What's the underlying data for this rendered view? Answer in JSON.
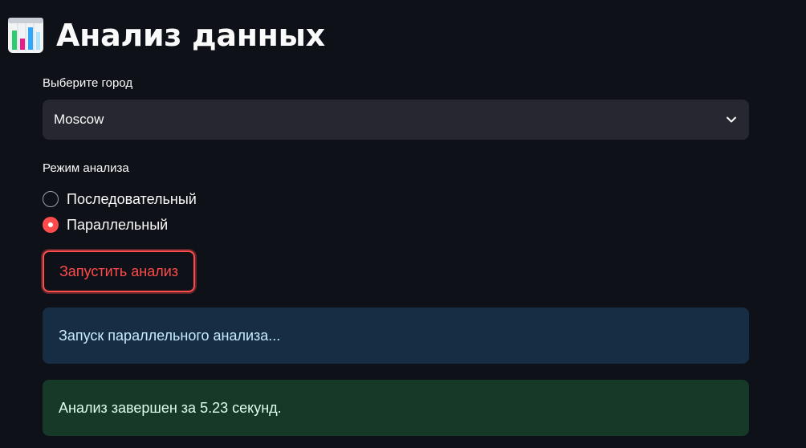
{
  "header": {
    "title": "Анализ данных",
    "icon": "bar-chart-icon"
  },
  "city_select": {
    "label": "Выберите город",
    "value": "Moscow"
  },
  "mode": {
    "label": "Режим анализа",
    "options": [
      {
        "label": "Последовательный",
        "selected": false
      },
      {
        "label": "Параллельный",
        "selected": true
      }
    ]
  },
  "actions": {
    "run_label": "Запустить анализ"
  },
  "messages": {
    "info": "Запуск параллельного анализа...",
    "success": "Анализ завершен за 5.23 секунд."
  },
  "colors": {
    "background": "#0e1117",
    "accent": "#ff4b4b",
    "info_bg": "#172d43",
    "success_bg": "#173928"
  }
}
